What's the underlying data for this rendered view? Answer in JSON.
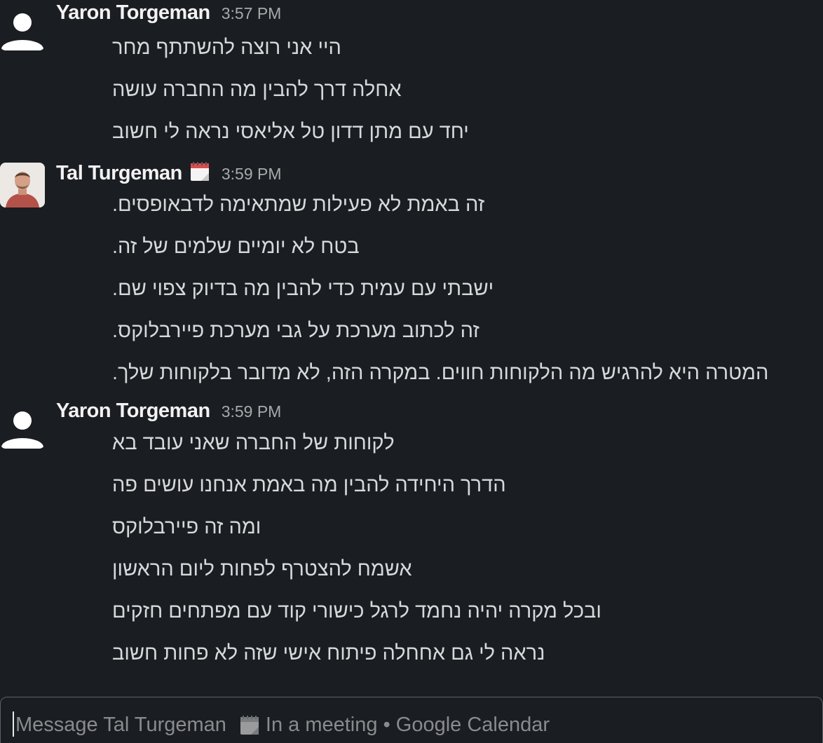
{
  "messages": [
    {
      "sender": "Yaron Torgeman",
      "time": "3:57 PM",
      "avatar": "default-user-icon",
      "lines": [
        "היי אני רוצה להשתתף מחר",
        "אחלה דרך להבין מה החברה עושה",
        "יחד עם מתן דדון טל אליאסי נראה לי חשוב"
      ]
    },
    {
      "sender": "Tal Turgeman",
      "time": "3:59 PM",
      "avatar": "user-photo",
      "status_icon": "calendar-icon",
      "lines": [
        "זה באמת לא פעילות שמתאימה לדבאופסים.",
        "בטח לא יומיים שלמים של זה.",
        "ישבתי עם עמית כדי להבין מה בדיוק צפוי שם.",
        "זה לכתוב מערכת על גבי מערכת פיירבלוקס.",
        "המטרה היא להרגיש מה הלקוחות חווים. במקרה הזה, לא מדובר בלקוחות שלך."
      ]
    },
    {
      "sender": "Yaron Torgeman",
      "time": "3:59 PM",
      "avatar": "default-user-icon",
      "lines": [
        "לקוחות של החברה שאני עובד בא",
        "הדרך היחידה להבין מה באמת אנחנו עושים פה",
        "ומה זה פיירבלוקס",
        "אשמח להצטרף לפחות ליום הראשון",
        "ובכל מקרה יהיה נחמד לרגל כישורי קוד עם מפתחים חזקים",
        "נראה לי גם אחחלה פיתוח אישי שזה לא פחות חשוב"
      ]
    }
  ],
  "composer": {
    "placeholder_prefix": "Message Tal Turgeman",
    "status_icon": "calendar-icon",
    "placeholder_status": "In a meeting • Google Calendar"
  },
  "colors": {
    "background": "#1a1d21",
    "name": "#f2f2f2",
    "text": "#d7d8d9",
    "timestamp": "#a8a9aa",
    "composer_border": "#5d6064"
  }
}
